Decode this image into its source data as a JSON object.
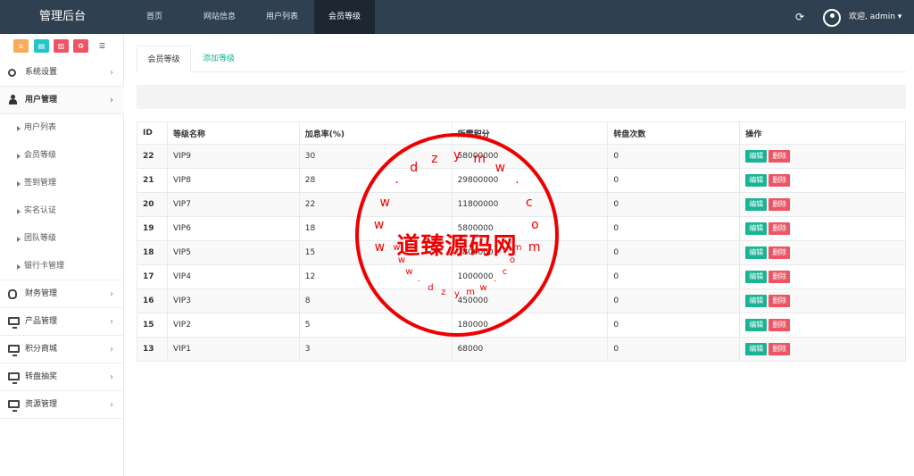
{
  "header": {
    "brand": "管理后台",
    "tabs": [
      "首页",
      "网站信息",
      "用户列表",
      "会员等级"
    ],
    "active_tab": 3,
    "refresh_icon": "refresh-icon",
    "welcome": "欢迎, admin ▾"
  },
  "shortcuts": [
    {
      "icon": "home-icon",
      "glyph": "⌂",
      "color": "#f8ac59"
    },
    {
      "icon": "file-icon",
      "glyph": "▤",
      "color": "#23c6c8"
    },
    {
      "icon": "trash-icon",
      "glyph": "▥",
      "color": "#ed5565"
    },
    {
      "icon": "recycle-icon",
      "glyph": "♻",
      "color": "#ed5565"
    },
    {
      "icon": "list-icon",
      "glyph": "☰",
      "color": "#ffffff"
    }
  ],
  "sidebar": {
    "items": [
      {
        "label": "系统设置",
        "icon": "gears-icon"
      },
      {
        "label": "用户管理",
        "icon": "user-icon",
        "open": true,
        "children": [
          "用户列表",
          "会员等级",
          "签到管理",
          "实名认证",
          "团队等级",
          "银行卡管理"
        ]
      },
      {
        "label": "财务管理",
        "icon": "database-icon"
      },
      {
        "label": "产品管理",
        "icon": "monitor-icon"
      },
      {
        "label": "积分商城",
        "icon": "monitor-icon"
      },
      {
        "label": "转盘抽奖",
        "icon": "monitor-icon"
      },
      {
        "label": "资源管理",
        "icon": "monitor-icon"
      }
    ]
  },
  "content_tabs": {
    "active": "会员等级",
    "add": "添加等级"
  },
  "table": {
    "headers": [
      "ID",
      "等级名称",
      "加息率(%)",
      "所需积分",
      "转盘次数",
      "操作"
    ],
    "edit_label": "编辑",
    "delete_label": "删除",
    "rows": [
      [
        "22",
        "VIP9",
        "30",
        "58000000",
        "0"
      ],
      [
        "21",
        "VIP8",
        "28",
        "29800000",
        "0"
      ],
      [
        "20",
        "VIP7",
        "22",
        "11800000",
        "0"
      ],
      [
        "19",
        "VIP6",
        "18",
        "5800000",
        "0"
      ],
      [
        "18",
        "VIP5",
        "15",
        "2800000",
        "0"
      ],
      [
        "17",
        "VIP4",
        "12",
        "1000000",
        "0"
      ],
      [
        "16",
        "VIP3",
        "8",
        "450000",
        "0"
      ],
      [
        "15",
        "VIP2",
        "5",
        "180000",
        "0"
      ],
      [
        "13",
        "VIP1",
        "3",
        "68000",
        "0"
      ]
    ]
  },
  "watermark": {
    "text": "道臻源码网",
    "top_chars": [
      "w",
      "w",
      "w",
      "·",
      "d",
      "z",
      "y",
      "m",
      "w",
      "·",
      "c",
      "o",
      "m"
    ],
    "bottom_chars": [
      "w",
      "w",
      "w",
      "·",
      "d",
      "z",
      "y",
      "m",
      "w",
      "·",
      "c",
      "o",
      "m"
    ],
    "color": "#e00000"
  }
}
